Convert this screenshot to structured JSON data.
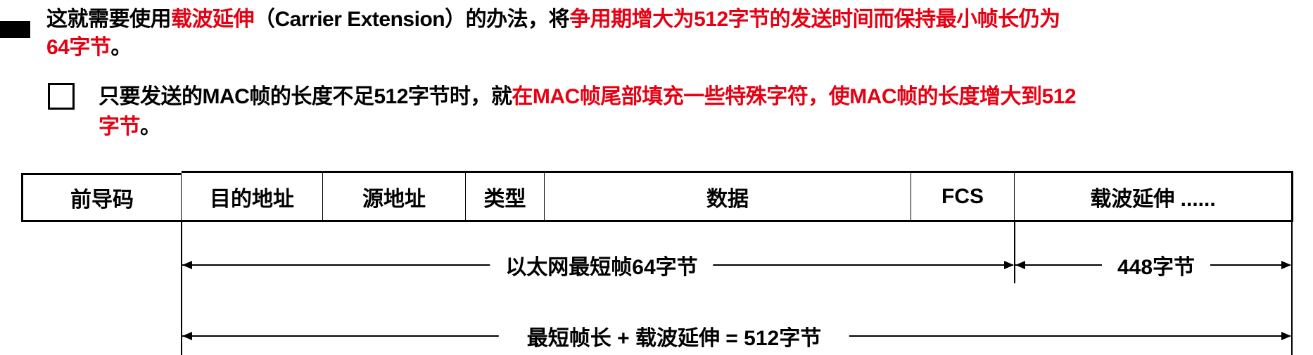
{
  "paragraph1": {
    "t1": "这就需要使用",
    "t2": "载波延伸",
    "t3": "（Carrier Extension）的办法，将",
    "t4": "争用期增大为512字节的发送时间而保持最小帧长仍为",
    "t5": "64字节",
    "t6": "。"
  },
  "paragraph2": {
    "t1": "只要发送的MAC帧的长度不足512字节时，就",
    "t2": "在MAC帧尾部填充一些特殊字符，使MAC帧的长度增大到512",
    "t3": "字节",
    "t4": "。"
  },
  "frame": {
    "fields": [
      "前导码",
      "目的地址",
      "源地址",
      "类型",
      "数据",
      "FCS",
      "载波延伸 ......"
    ]
  },
  "dimensions": {
    "min_frame": "以太网最短帧64字节",
    "extension": "448字节",
    "total": "最短帧长 + 载波延伸 = 512字节"
  },
  "colors": {
    "highlight": "#e60012",
    "text": "#000000"
  }
}
